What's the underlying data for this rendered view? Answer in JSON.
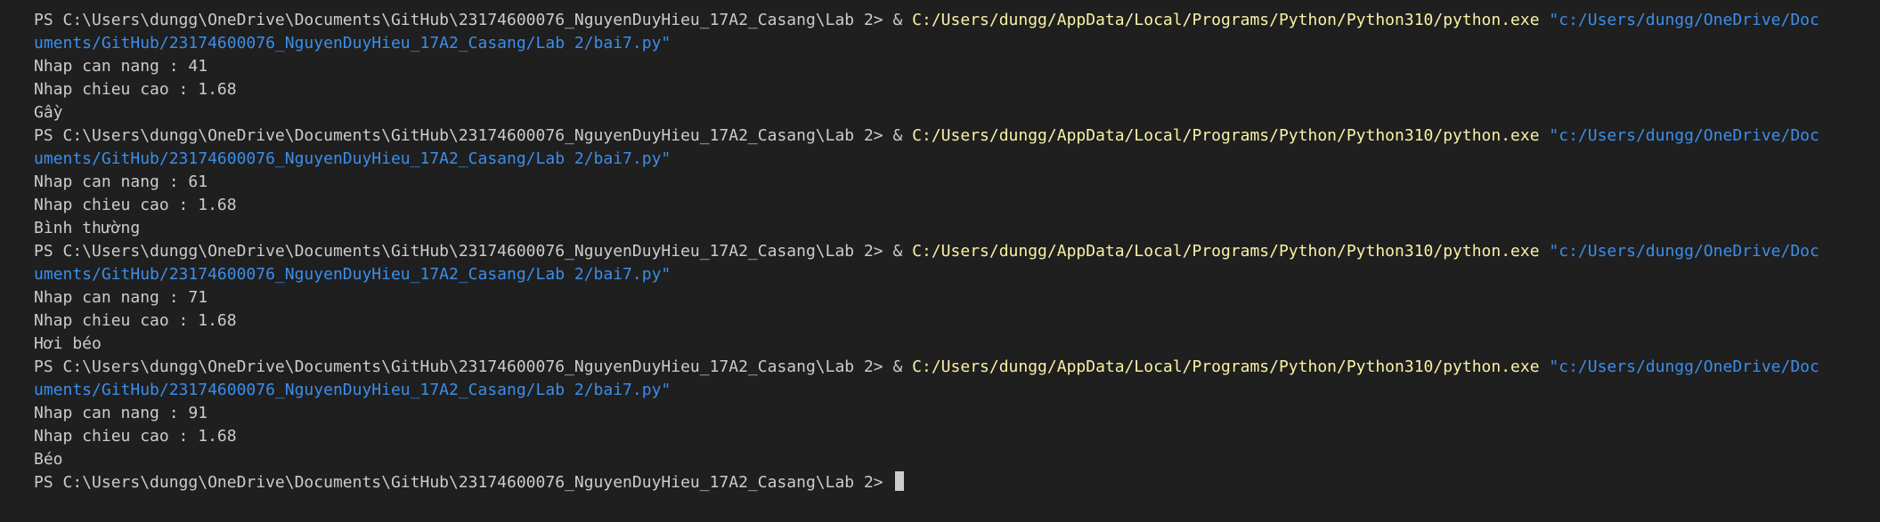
{
  "terminal": {
    "runs": [
      {
        "prompt": "PS C:\\Users\\dungg\\OneDrive\\Documents\\GitHub\\23174600076_NguyenDuyHieu_17A2_Casang\\Lab 2> & ",
        "exe": "C:/Users/dungg/AppData/Local/Programs/Python/Python310/python.exe",
        "arg_part1": " \"c:/Users/dungg/OneDrive/Doc",
        "arg_part2": "uments/GitHub/23174600076_NguyenDuyHieu_17A2_Casang/Lab 2/bai7.py\"",
        "line1": "Nhap can nang : 41",
        "line2": "Nhap chieu cao : 1.68",
        "result": "Gầy"
      },
      {
        "prompt": "PS C:\\Users\\dungg\\OneDrive\\Documents\\GitHub\\23174600076_NguyenDuyHieu_17A2_Casang\\Lab 2> & ",
        "exe": "C:/Users/dungg/AppData/Local/Programs/Python/Python310/python.exe",
        "arg_part1": " \"c:/Users/dungg/OneDrive/Doc",
        "arg_part2": "uments/GitHub/23174600076_NguyenDuyHieu_17A2_Casang/Lab 2/bai7.py\"",
        "line1": "Nhap can nang : 61",
        "line2": "Nhap chieu cao : 1.68",
        "result": "Bình thường"
      },
      {
        "prompt": "PS C:\\Users\\dungg\\OneDrive\\Documents\\GitHub\\23174600076_NguyenDuyHieu_17A2_Casang\\Lab 2> & ",
        "exe": "C:/Users/dungg/AppData/Local/Programs/Python/Python310/python.exe",
        "arg_part1": " \"c:/Users/dungg/OneDrive/Doc",
        "arg_part2": "uments/GitHub/23174600076_NguyenDuyHieu_17A2_Casang/Lab 2/bai7.py\"",
        "line1": "Nhap can nang : 71",
        "line2": "Nhap chieu cao : 1.68",
        "result": "Hơi béo"
      },
      {
        "prompt": "PS C:\\Users\\dungg\\OneDrive\\Documents\\GitHub\\23174600076_NguyenDuyHieu_17A2_Casang\\Lab 2> & ",
        "exe": "C:/Users/dungg/AppData/Local/Programs/Python/Python310/python.exe",
        "arg_part1": " \"c:/Users/dungg/OneDrive/Doc",
        "arg_part2": "uments/GitHub/23174600076_NguyenDuyHieu_17A2_Casang/Lab 2/bai7.py\"",
        "line1": "Nhap can nang : 91",
        "line2": "Nhap chieu cao : 1.68",
        "result": "Béo"
      }
    ],
    "final_prompt": "PS C:\\Users\\dungg\\OneDrive\\Documents\\GitHub\\23174600076_NguyenDuyHieu_17A2_Casang\\Lab 2> "
  },
  "colors": {
    "background": "#1f1f1f",
    "text": "#cccccc",
    "exe_path": "#f9f1a5",
    "string_arg": "#3b8eea"
  }
}
